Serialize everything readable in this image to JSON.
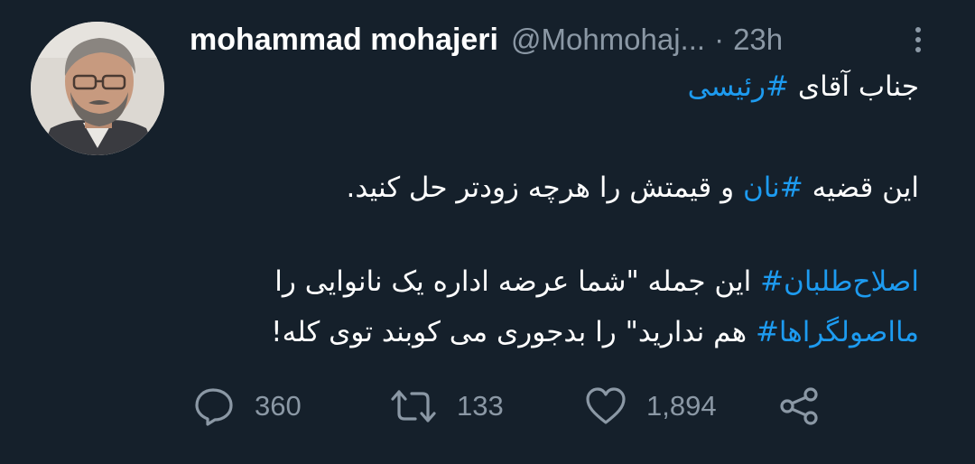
{
  "author": {
    "display_name": "mohammad mohajeri",
    "handle": "@Mohmohaj...",
    "separator": "·",
    "time": "23h"
  },
  "tweet": {
    "line1": {
      "text": "جناب آقای ",
      "tag": "#رئیسی"
    },
    "line2": {
      "before": "این قضیه ",
      "tag": "#نان",
      "after": " و قیمتش  را هرچه زودتر حل کنید."
    },
    "line3": {
      "tag": "اصلاح‌طلبان#",
      "after": " این جمله \"شما عرضه اداره یک نانوایی را"
    },
    "line4": {
      "tag": "مااصولگراها#",
      "after": " هم ندارید\" را بدجوری می کوبند توی کله!"
    }
  },
  "actions": {
    "replies": "360",
    "retweets": "133",
    "likes": "1,894"
  },
  "colors": {
    "background": "#15202b",
    "text": "#ffffff",
    "muted": "#8b98a5",
    "link": "#1d9bf0"
  },
  "icons": [
    "reply-icon",
    "retweet-icon",
    "like-icon",
    "share-icon",
    "more-options-icon"
  ]
}
